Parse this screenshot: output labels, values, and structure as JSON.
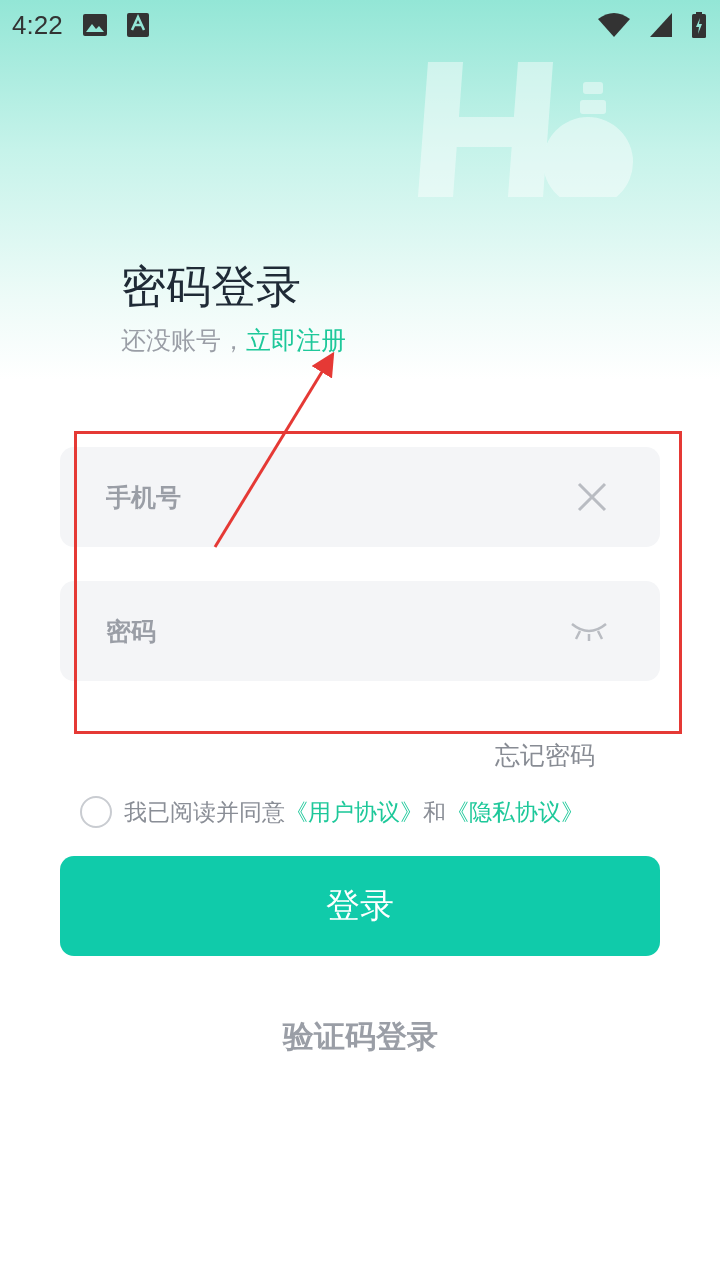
{
  "status_bar": {
    "time": "4:22"
  },
  "title": "密码登录",
  "register_prompt": {
    "text": "还没账号，",
    "link": "立即注册"
  },
  "fields": [
    {
      "kind": "phone",
      "placeholder": "手机号"
    },
    {
      "kind": "password",
      "placeholder": "密码"
    }
  ],
  "forgot_password": "忘记密码",
  "agreement": {
    "checked": false,
    "text": "我已阅读并同意",
    "joiner": "和",
    "links": [
      "《用户协议》",
      "《隐私协议》"
    ]
  },
  "login_button": "登录",
  "alt_login": "验证码登录"
}
